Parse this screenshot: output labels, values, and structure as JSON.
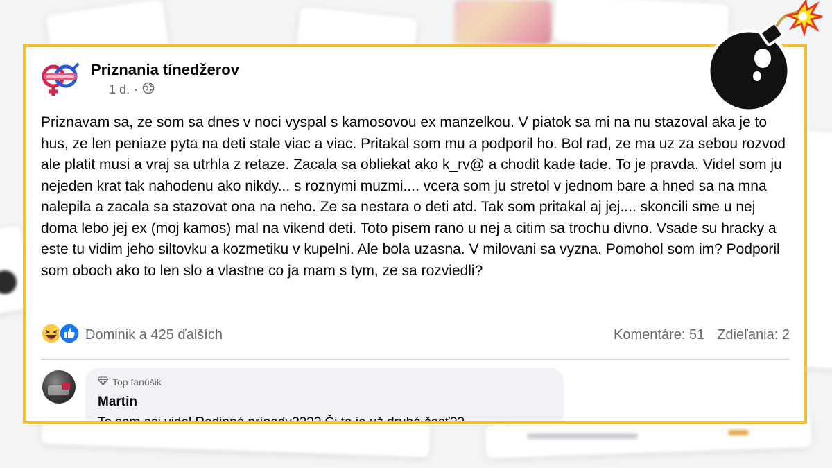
{
  "post": {
    "page_name": "Priznania tínedžerov",
    "time": "1 d.",
    "separator": "·",
    "text": "Priznavam sa, ze som sa dnes v noci vyspal s kamosovou ex manzelkou. V piatok sa mi na nu stazoval aka je to hus, ze len peniaze pyta na deti stale viac a viac. Pritakal som mu a podporil ho. Bol rad, ze ma uz za sebou rozvod ale platit musi a vraj sa utrhla z retaze. Zacala sa obliekat ako k_rv@ a chodit kade tade. To je pravda. Videl som ju nejeden krat tak nahodenu ako nikdy... s roznymi muzmi.... vcera som ju stretol v jednom bare a hned sa na mna nalepila a zacala sa stazovat ona na neho. Ze sa nestara o deti atd. Tak som pritakal aj jej.... skoncili sme u nej doma lebo jej ex (moj kamos) mal na vikend deti. Toto pisem rano u nej a citim sa trochu divno. Vsade su hracky a este tu vidim jeho siltovku a kozmetiku v kupelni. Ale bola uzasna. V milovani sa vyzna. Pomohol som im? Podporil som oboch ako to len slo a vlastne co ja mam s tym, ze sa rozviedli?"
  },
  "reactions": {
    "icons": [
      "haha-icon",
      "like-icon"
    ],
    "summary": "Dominik a 425 ďalších",
    "comments": "Komentáre: 51",
    "shares": "Zdieľania: 2"
  },
  "comment": {
    "badge": "Top fanúšik",
    "author": "Martin",
    "text": "To som asi videl Rodinné prípady???? Či to je už druhá časť??"
  },
  "colors": {
    "frame_border": "#f4c12c",
    "text_primary": "#050505",
    "text_secondary": "#65676b",
    "like_blue": "#1877f2",
    "comment_bg": "#f0f2f5"
  }
}
